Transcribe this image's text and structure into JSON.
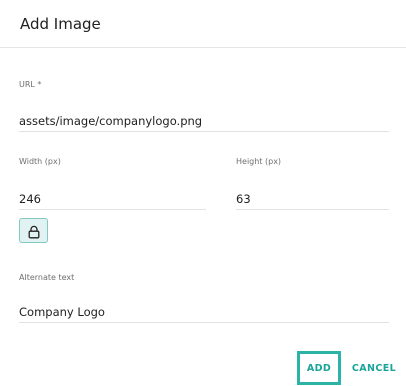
{
  "dialog": {
    "title": "Add Image"
  },
  "url": {
    "label": "URL *",
    "value": "assets/image/companylogo.png"
  },
  "width": {
    "label": "Width (px)",
    "value": "246"
  },
  "height": {
    "label": "Height (px)",
    "value": "63"
  },
  "lock": {
    "icon": "lock-icon"
  },
  "alt": {
    "label": "Alternate text",
    "value": "Company Logo"
  },
  "actions": {
    "add_label": "ADD",
    "cancel_label": "CANCEL"
  },
  "colors": {
    "accent": "#1aa39a",
    "lock_bg": "#e0f3f2"
  }
}
